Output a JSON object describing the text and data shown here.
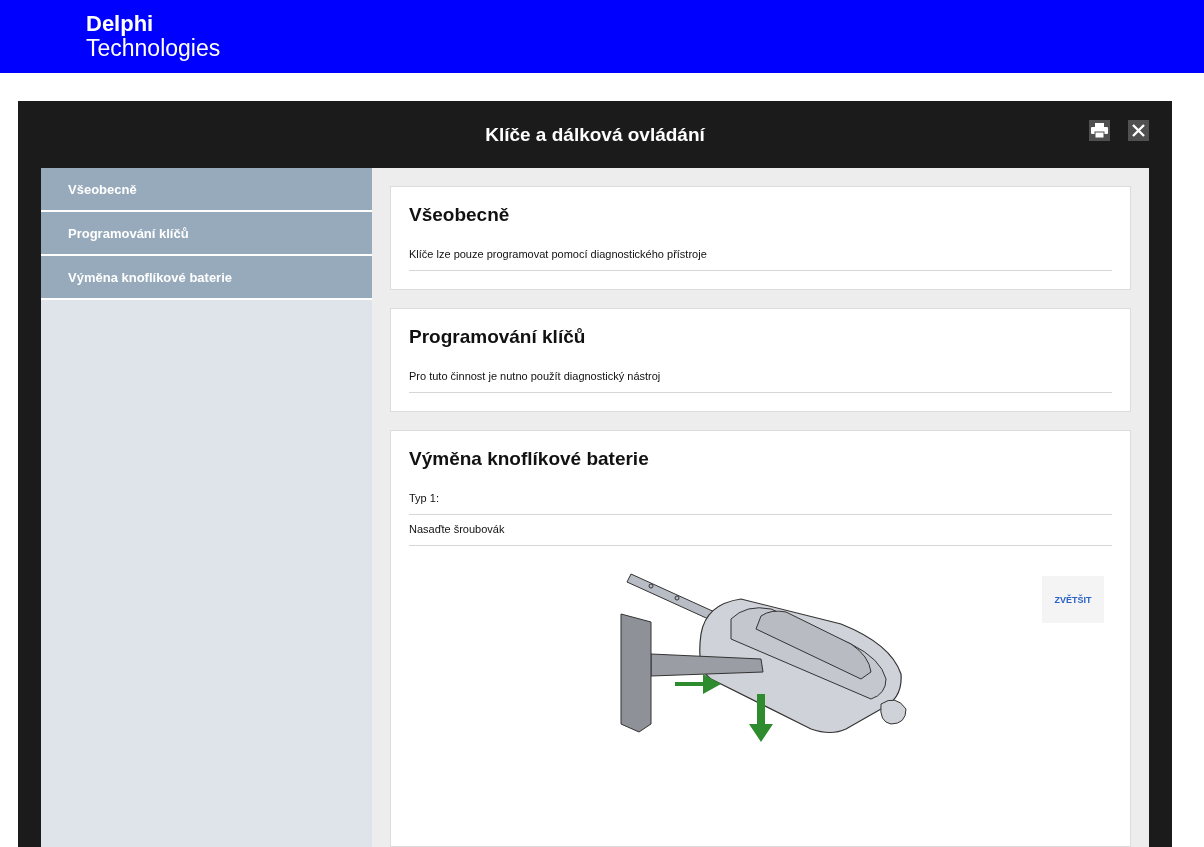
{
  "header": {
    "logo": [
      "Delphi",
      "Technologies"
    ]
  },
  "dialog": {
    "title": "Klíče a dálková ovládání",
    "sidebar": {
      "items": [
        {
          "label": "Všeobecně"
        },
        {
          "label": "Programování klíčů"
        },
        {
          "label": "Výměna knoflíkové baterie"
        }
      ]
    },
    "sections": [
      {
        "title": "Všeobecně",
        "lines": [
          "Klíče lze pouze programovat pomocí diagnostického přístroje"
        ]
      },
      {
        "title": "Programování klíčů",
        "lines": [
          "Pro tuto činnost je nutno použít diagnostický nástroj"
        ]
      },
      {
        "title": "Výměna knoflíkové baterie",
        "lines": [
          "Typ 1:",
          "Nasaďte šroubovák"
        ],
        "figure": {
          "zoom_button": "ZVĚTŠIT"
        }
      }
    ]
  }
}
